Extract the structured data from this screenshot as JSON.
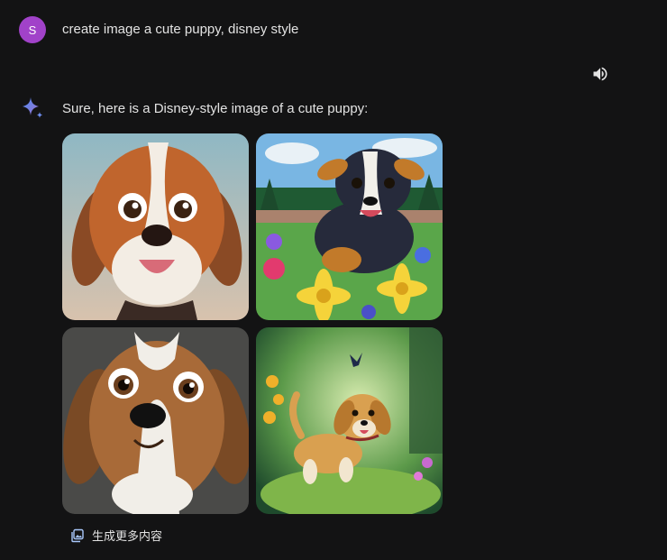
{
  "user": {
    "avatar_letter": "S",
    "avatar_color": "#a142c9",
    "prompt": "create image a cute puppy, disney style"
  },
  "response": {
    "icon": "gemini-sparkle-icon",
    "text": "Sure, here is a Disney-style image of a cute puppy:",
    "speaker_icon": "speaker-icon",
    "images": [
      {
        "name": "brown-white-puppy-closeup"
      },
      {
        "name": "tricolor-puppy-running-flowers"
      },
      {
        "name": "brown-puppy-big-eyes"
      },
      {
        "name": "golden-puppy-forest-butterfly"
      }
    ],
    "generate_more_icon": "image-stack-icon",
    "generate_more_label": "生成更多内容"
  }
}
